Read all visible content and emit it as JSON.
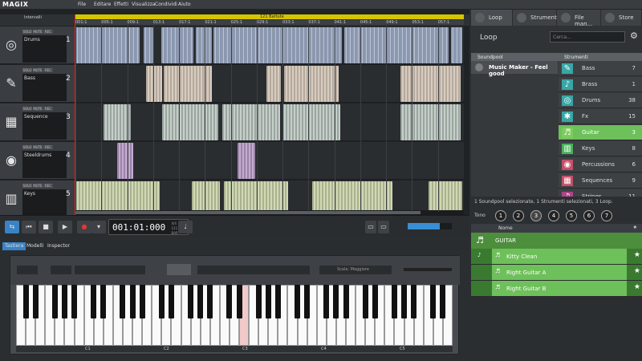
{
  "app": {
    "logo": "MAGIX",
    "menus": [
      "File",
      "Editare",
      "Effetti",
      "Visualizza",
      "Condividi",
      "Aiuto"
    ]
  },
  "arranger": {
    "range_label": "121 Battute",
    "ticks": [
      "001:1",
      "005:1",
      "009:1",
      "013:1",
      "017:1",
      "021:1",
      "025:1",
      "029:1",
      "033:1",
      "037:1",
      "041:1",
      "045:1",
      "049:1",
      "053:1",
      "057:1"
    ],
    "header_label": "Intervalli",
    "tracks": [
      {
        "name": "Drums",
        "num": "1",
        "icon": "drums-icon",
        "glyph": "◎",
        "btns": [
          "SOLO",
          "MUTE",
          "REC"
        ]
      },
      {
        "name": "Bass",
        "num": "2",
        "icon": "bass-guitar-icon",
        "glyph": "✎",
        "btns": [
          "SOLO",
          "MUTE",
          "REC"
        ]
      },
      {
        "name": "Sequence",
        "num": "3",
        "icon": "sequencer-icon",
        "glyph": "▦",
        "btns": [
          "SOLO",
          "MUTE",
          "REC"
        ]
      },
      {
        "name": "Steeldrums",
        "num": "4",
        "icon": "steeldrum-icon",
        "glyph": "◉",
        "btns": [
          "SOLO",
          "MUTE",
          "REC"
        ]
      },
      {
        "name": "Keys",
        "num": "5",
        "icon": "keys-icon",
        "glyph": "▥",
        "btns": [
          "SOLO",
          "MUTE",
          "REC"
        ]
      }
    ]
  },
  "transport": {
    "time": "001:01:000",
    "meter": "4/4",
    "bpm": "121 BPM",
    "bars": "BAR",
    "zoom_label": "Zoom"
  },
  "right": {
    "tabs": [
      "Loop",
      "Strumenti",
      "File man...",
      "Store"
    ],
    "loop_title": "Loop",
    "search_placeholder": "Cerca...",
    "col_soundpool": "Soundpool",
    "col_strumenti": "Strumenti",
    "soundpool_item": "Music Maker - Feel good",
    "instruments": [
      {
        "name": "Bass",
        "count": "7",
        "color": "#3aa6a6",
        "icon": "bass-icon",
        "glyph": "✎"
      },
      {
        "name": "Brass",
        "count": "1",
        "color": "#3aa6a6",
        "icon": "brass-icon",
        "glyph": "♪"
      },
      {
        "name": "Drums",
        "count": "38",
        "color": "#3aa6a6",
        "icon": "drums-icon",
        "glyph": "◎"
      },
      {
        "name": "Fx",
        "count": "15",
        "color": "#3aa6a6",
        "icon": "fx-icon",
        "glyph": "✱"
      },
      {
        "name": "Guitar",
        "count": "3",
        "color": "#7ecb5e",
        "icon": "guitar-icon",
        "glyph": "♬"
      },
      {
        "name": "Keys",
        "count": "8",
        "color": "#49b25a",
        "icon": "keys-icon",
        "glyph": "▥"
      },
      {
        "name": "Percussions",
        "count": "6",
        "color": "#c4506a",
        "icon": "percussion-icon",
        "glyph": "◉"
      },
      {
        "name": "Sequences",
        "count": "9",
        "color": "#c4506a",
        "icon": "sequences-icon",
        "glyph": "▦"
      },
      {
        "name": "Strings",
        "count": "11",
        "color": "#b0448a",
        "icon": "strings-icon",
        "glyph": "♫"
      }
    ],
    "status": "1 Soundpool selezionate, 1 Strumenti selezionati, 3 Loop.",
    "tone_label": "Tono",
    "tones": [
      "1",
      "2",
      "3",
      "4",
      "5",
      "6",
      "7"
    ],
    "loop_col": "Nome",
    "guitar_header": "GUITAR",
    "loops": [
      "Kitty Clean",
      "Right Guitar A",
      "Right Guitar B"
    ]
  },
  "lower": {
    "tabs": [
      "Tastiera",
      "Modelli",
      "Inspector"
    ],
    "octaves": [
      "C1",
      "C2",
      "C3",
      "C4",
      "C5"
    ],
    "scale_label": "Scala: Maggiore"
  }
}
